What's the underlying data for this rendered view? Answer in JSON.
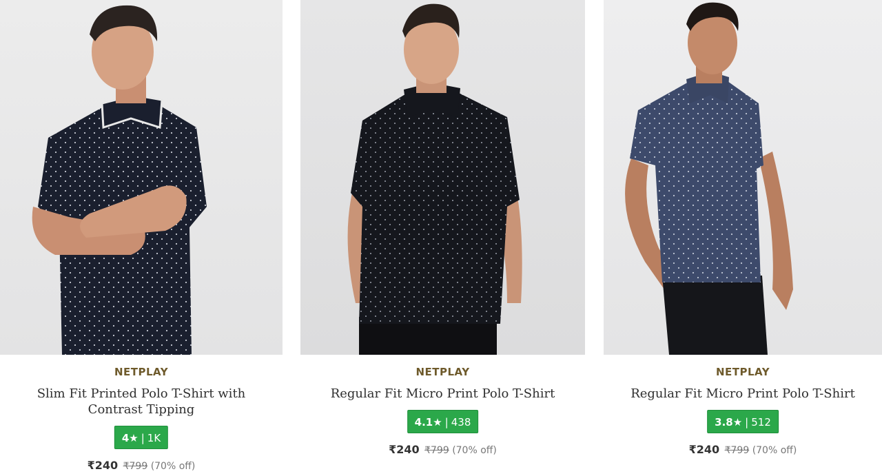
{
  "products": [
    {
      "brand": "NETPLAY",
      "title": "Slim Fit Printed Polo T-Shirt with Contrast Tipping",
      "rating": "4",
      "star": "★",
      "reviews": "1K",
      "price": "₹240",
      "mrp": "₹799",
      "discount": "(70% off)",
      "shirt_color": "#1a1f2e"
    },
    {
      "brand": "NETPLAY",
      "title": "Regular Fit Micro Print Polo T-Shirt",
      "rating": "4.1",
      "star": "★",
      "reviews": "438",
      "price": "₹240",
      "mrp": "₹799",
      "discount": "(70% off)",
      "shirt_color": "#15171d"
    },
    {
      "brand": "NETPLAY",
      "title": "Regular Fit Micro Print Polo T-Shirt",
      "rating": "3.8",
      "star": "★",
      "reviews": "512",
      "price": "₹240",
      "mrp": "₹799",
      "discount": "(70% off)",
      "shirt_color": "#3d4a6b"
    }
  ],
  "colors": {
    "brand": "#6e5a2b",
    "rating_badge": "#2ba84a"
  }
}
